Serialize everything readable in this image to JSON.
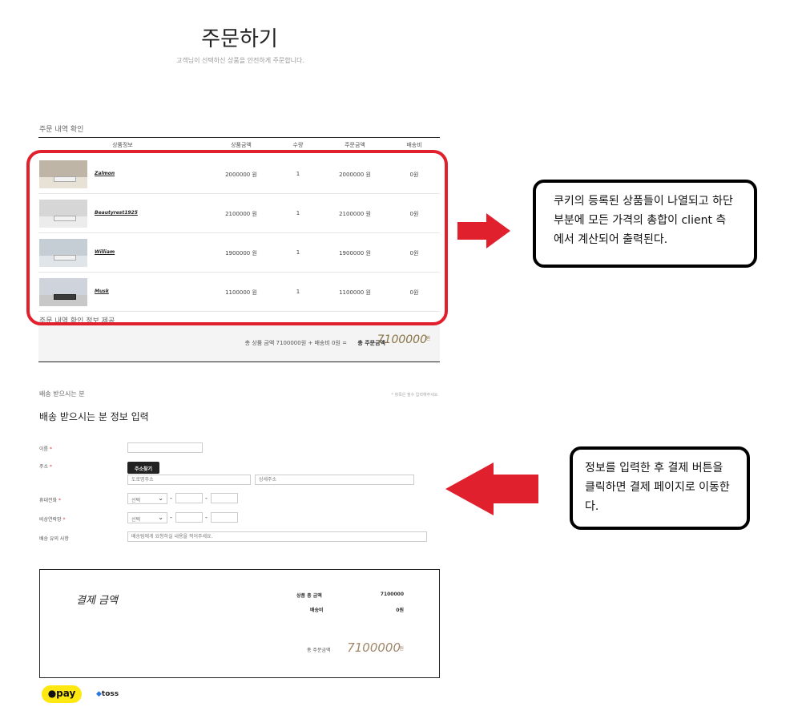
{
  "header": {
    "title": "주문하기",
    "subtitle": "고객님이 선택하신 상품을 안전하게 주문합니다."
  },
  "order_section": {
    "label": "주문 내역 확인",
    "columns": [
      "상품정보",
      "상품금액",
      "수량",
      "주문금액",
      "배송비"
    ],
    "rows": [
      {
        "name": "Zalmon",
        "price": "2000000 원",
        "qty": "1",
        "total": "2000000 원",
        "shipping": "0원"
      },
      {
        "name": "Beautyrest1925",
        "price": "2100000 원",
        "qty": "1",
        "total": "2100000 원",
        "shipping": "0원"
      },
      {
        "name": "William",
        "price": "1900000 원",
        "qty": "1",
        "total": "1900000 원",
        "shipping": "0원"
      },
      {
        "name": "Musk",
        "price": "1100000 원",
        "qty": "1",
        "total": "1100000 원",
        "shipping": "0원"
      }
    ],
    "footer_label": "주문 내역 확인 정보 제공",
    "summary_text": "총 상품 금액 7100000원 + 배송비 0원 =",
    "total_label": "총 주문금액",
    "total_value": "7100000",
    "total_unit": "원"
  },
  "shipping": {
    "section_label": "배송 받으시는 분",
    "required_note": "* 항목은 필수 입력해주세요.",
    "title": "배송 받으시는 분 정보 입력",
    "name_label": "이름",
    "address_label": "주소",
    "address_button": "주소찾기",
    "road_address_placeholder": "도로명주소",
    "detail_address_placeholder": "상세주소",
    "phone_label": "휴대전화",
    "emergency_label": "비상연락망",
    "select_default": "선택",
    "note_label": "배송 유의 사항",
    "note_placeholder": "배송팀에게 요청하실 내용을 적어주세요.",
    "required_mark": "*",
    "dash": "-"
  },
  "payment": {
    "title": "결제 금액",
    "subtotal_label": "상품 총 금액",
    "subtotal_value": "7100000",
    "shipping_label": "배송비",
    "shipping_value": "0원",
    "total_label": "총 주문금액",
    "total_value": "7100000",
    "total_unit": "원"
  },
  "pay_methods": {
    "kakao": "pay",
    "toss": "toss"
  },
  "callouts": {
    "first": "쿠키의 등록된 상품들이 나열되고 하단 부분에 모든 가격의 총합이 client 측에서 계산되어 출력된다.",
    "second": "정보를 입력한 후 결제 버튼을 클릭하면 결제 페이지로 이동한다."
  },
  "colors": {
    "highlight_red": "#e0202c",
    "total_gold": "#a0876a",
    "kakao_yellow": "#ffe812",
    "toss_blue": "#2b74e8"
  }
}
